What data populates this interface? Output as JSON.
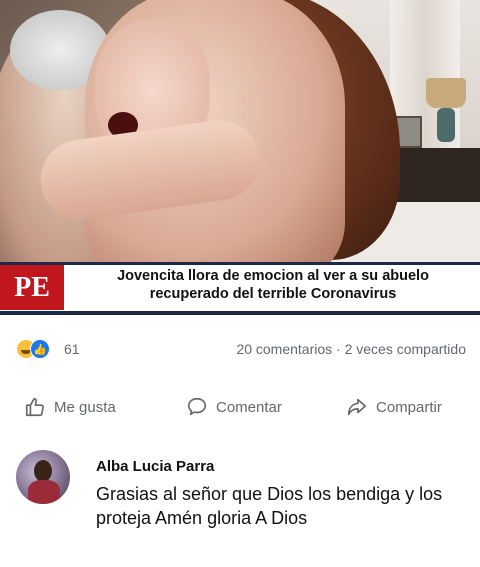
{
  "post": {
    "banner_logo": "PE",
    "headline_line1": "Jovencita llora de emocion al ver a su abuelo",
    "headline_line2": "recuperado del terrible Coronavirus"
  },
  "stats": {
    "reaction_count": "61",
    "comments_shares": "20 comentarios · 2 veces compartido",
    "reactions": [
      "haha-icon",
      "like-icon"
    ]
  },
  "actions": {
    "like": "Me gusta",
    "comment": "Comentar",
    "share": "Compartir"
  },
  "comment": {
    "author": "Alba Lucia Parra",
    "text": "Grasias al señor que Dios los bendiga y los proteja Amén gloria A Dios"
  },
  "colors": {
    "brand_red": "#c0171c",
    "navy": "#1b2a4a",
    "like_blue": "#1877f2",
    "muted_text": "#65676b"
  }
}
